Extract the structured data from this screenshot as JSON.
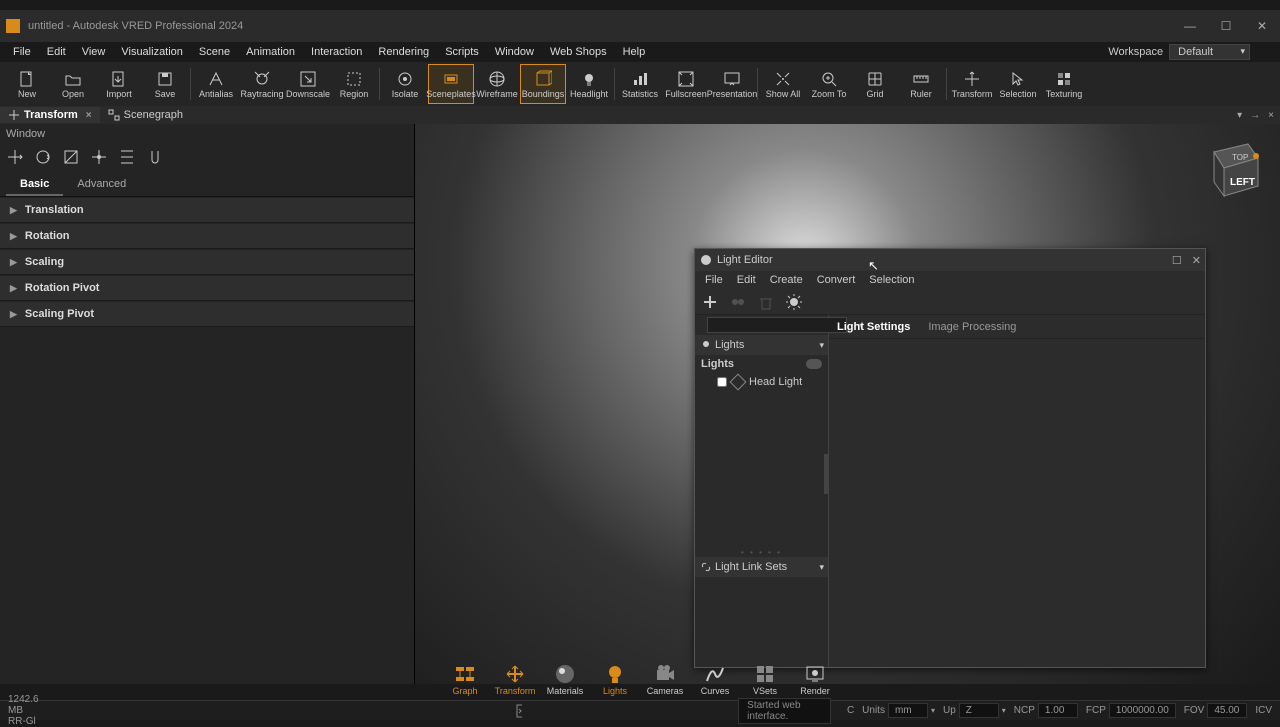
{
  "titlebar": {
    "title": "untitled - Autodesk VRED Professional 2024"
  },
  "menubar": {
    "items": [
      "File",
      "Edit",
      "View",
      "Visualization",
      "Scene",
      "Animation",
      "Interaction",
      "Rendering",
      "Scripts",
      "Window",
      "Web Shops",
      "Help"
    ],
    "workspace_label": "Workspace",
    "workspace_value": "Default"
  },
  "toolbar": {
    "items": [
      "New",
      "Open",
      "Import",
      "Save",
      "Antialias",
      "Raytracing",
      "Downscale",
      "Region",
      "Isolate",
      "Sceneplates",
      "Wireframe",
      "Boundings",
      "Headlight",
      "Statistics",
      "Fullscreen",
      "Presentation",
      "Show All",
      "Zoom To",
      "Grid",
      "Ruler",
      "Transform",
      "Selection",
      "Texturing"
    ],
    "active": [
      "Sceneplates",
      "Boundings"
    ]
  },
  "panel_tabs": {
    "transform": "Transform",
    "scenegraph": "Scenegraph"
  },
  "left_panel": {
    "window_menu": "Window",
    "tab_basic": "Basic",
    "tab_advanced": "Advanced",
    "sections": [
      "Translation",
      "Rotation",
      "Scaling",
      "Rotation Pivot",
      "Scaling Pivot"
    ]
  },
  "viewcube": {
    "top": "TOP",
    "left": "LEFT"
  },
  "light_editor": {
    "title": "Light Editor",
    "menu": [
      "File",
      "Edit",
      "Create",
      "Convert",
      "Selection"
    ],
    "lights_header": "Lights",
    "lights_cat": "Lights",
    "head_light": "Head Light",
    "link_sets": "Light Link Sets",
    "tab_settings": "Light Settings",
    "tab_image": "Image Processing"
  },
  "bottom_tabs": [
    "Graph",
    "Transform",
    "Materials",
    "Lights",
    "Cameras",
    "Curves",
    "VSets",
    "Render"
  ],
  "statusbar": {
    "mem": "1242.6 MB  RR-Gl",
    "console_msg": "Started web interface.",
    "units_label": "Units",
    "units_val": "mm",
    "up_label": "Up",
    "up_val": "Z",
    "ncp_label": "NCP",
    "ncp_val": "1.00",
    "fcp_label": "FCP",
    "fcp_val": "1000000.00",
    "fov_label": "FOV",
    "fov_val": "45.00",
    "icv_label": "ICV",
    "c_label": "C"
  }
}
